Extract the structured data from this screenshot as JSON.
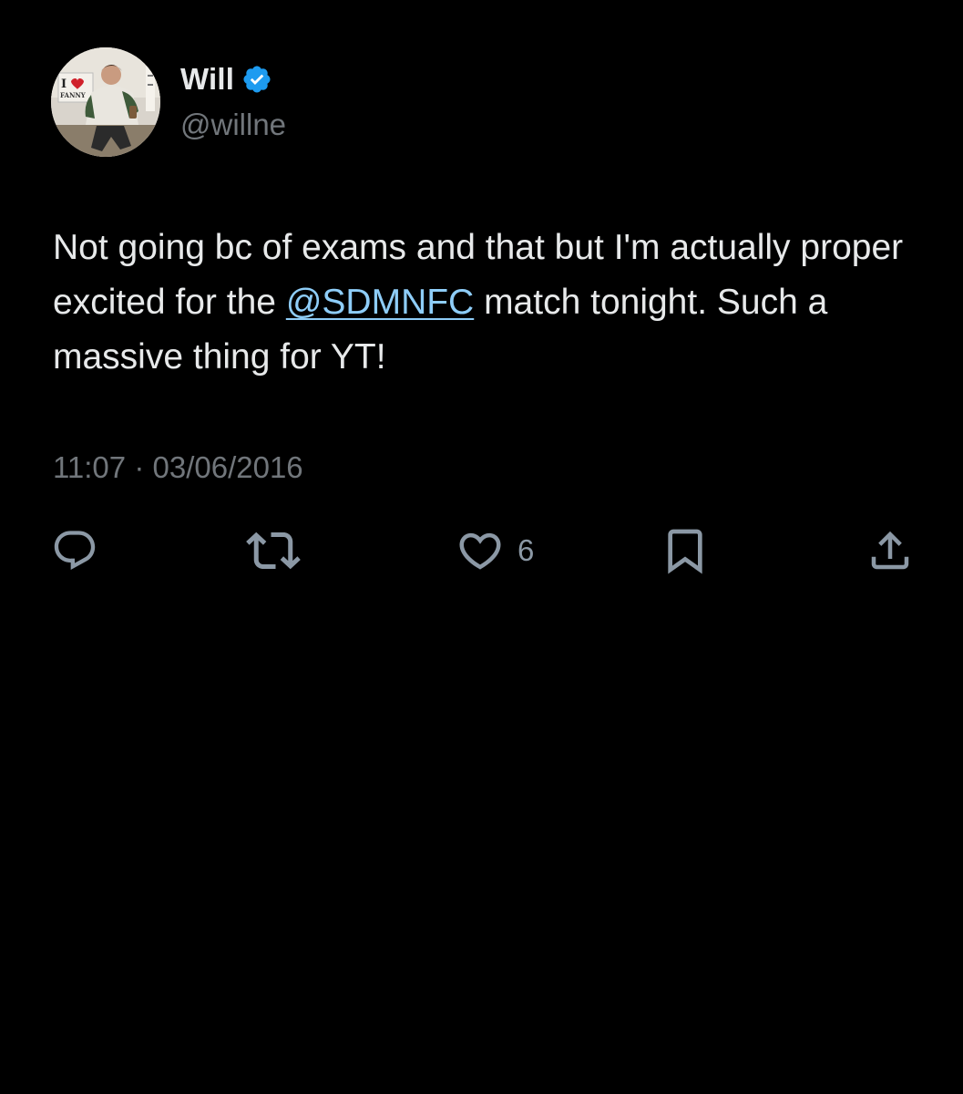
{
  "author": {
    "display_name": "Will",
    "handle": "@willne",
    "verified": true,
    "verified_color": "#1d9bf0",
    "avatar_sign_text": "I FANNY"
  },
  "tweet": {
    "text_before": "Not going bc of exams and that but I'm actually proper excited for the ",
    "mention": "@SDMNFC",
    "text_after": " match tonight. Such a massive thing for YT!",
    "time": "11:07",
    "separator": "·",
    "date": "03/06/2016"
  },
  "actions": {
    "reply_icon": "reply-icon",
    "retweet_icon": "retweet-icon",
    "like_icon": "heart-icon",
    "like_count": "6",
    "bookmark_icon": "bookmark-icon",
    "share_icon": "share-icon"
  },
  "colors": {
    "background": "#000000",
    "text_primary": "#e7e9ea",
    "text_secondary": "#71767b",
    "link": "#8ecdf8"
  }
}
